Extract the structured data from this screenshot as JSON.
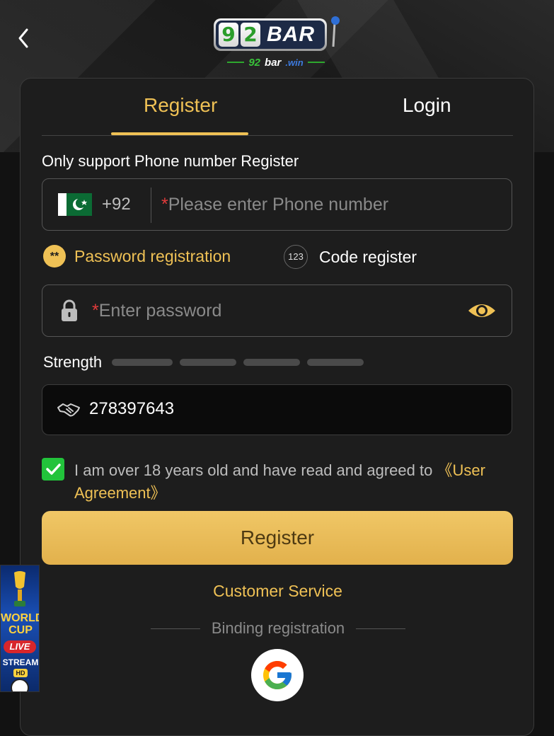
{
  "header": {
    "logo_reel_1": "9",
    "logo_reel_2": "2",
    "logo_text": "BAR",
    "logo_sub_num": "92",
    "logo_sub_bar": "bar",
    "logo_sub_domain": ".win"
  },
  "tabs": [
    {
      "label": "Register",
      "active": true
    },
    {
      "label": "Login",
      "active": false
    }
  ],
  "form": {
    "note": "Only support Phone number Register",
    "country_code": "+92",
    "required_mark": "*",
    "phone_placeholder": "Please enter Phone number",
    "options": [
      {
        "icon_text": "**",
        "label": "Password registration",
        "selected": true
      },
      {
        "icon_text": "123",
        "label": "Code register",
        "selected": false
      }
    ],
    "password_placeholder": "Enter password",
    "strength_label": "Strength",
    "invite_code": "278397643",
    "agreement_text": "I am over 18 years old and have read and agreed to ",
    "agreement_link": "《User Agreement》",
    "agreement_checked": true,
    "register_button": "Register",
    "customer_service": "Customer Service",
    "binding_label": "Binding registration"
  },
  "promo": {
    "title_line1": "WORLD",
    "title_line2": "CUP",
    "live": "LIVE",
    "stream": "STREAM",
    "hd": "HD"
  },
  "colors": {
    "accent": "#efc155",
    "background": "#121212",
    "panel": "#1d1d1d",
    "checkbox": "#22c33b",
    "required": "#e23b3b"
  },
  "icons": [
    "back-arrow-icon",
    "pakistan-flag-icon",
    "lock-icon",
    "eye-icon",
    "handshake-icon",
    "checkmark-icon",
    "google-icon"
  ]
}
